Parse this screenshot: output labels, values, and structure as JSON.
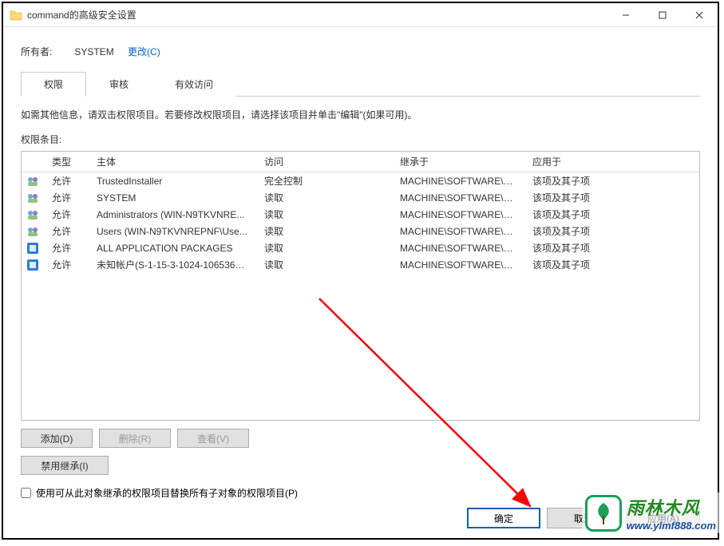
{
  "window": {
    "title": "command的高级安全设置"
  },
  "owner": {
    "label": "所有者:",
    "value": "SYSTEM",
    "change_link": "更改(C)"
  },
  "tabs": {
    "permissions": "权限",
    "auditing": "审核",
    "effective": "有效访问"
  },
  "info_text": "如需其他信息，请双击权限项目。若要修改权限项目，请选择该项目并单击\"编辑\"(如果可用)。",
  "entries_label": "权限条目:",
  "columns": {
    "type": "类型",
    "principal": "主体",
    "access": "访问",
    "inherited": "继承于",
    "applies": "应用于"
  },
  "rows": [
    {
      "icon": "users",
      "type": "允许",
      "principal": "TrustedInstaller",
      "access": "完全控制",
      "inherited": "MACHINE\\SOFTWARE\\Cl...",
      "applies": "该项及其子项"
    },
    {
      "icon": "users",
      "type": "允许",
      "principal": "SYSTEM",
      "access": "读取",
      "inherited": "MACHINE\\SOFTWARE\\Cl...",
      "applies": "该项及其子项"
    },
    {
      "icon": "users",
      "type": "允许",
      "principal": "Administrators (WIN-N9TKVNRE...",
      "access": "读取",
      "inherited": "MACHINE\\SOFTWARE\\Cl...",
      "applies": "该项及其子项"
    },
    {
      "icon": "users",
      "type": "允许",
      "principal": "Users (WIN-N9TKVNREPNF\\Use...",
      "access": "读取",
      "inherited": "MACHINE\\SOFTWARE\\Cl...",
      "applies": "该项及其子项"
    },
    {
      "icon": "app",
      "type": "允许",
      "principal": "ALL APPLICATION PACKAGES",
      "access": "读取",
      "inherited": "MACHINE\\SOFTWARE\\Cl...",
      "applies": "该项及其子项"
    },
    {
      "icon": "app",
      "type": "允许",
      "principal": "未知帐户(S-1-15-3-1024-1065365...",
      "access": "读取",
      "inherited": "MACHINE\\SOFTWARE\\Cl...",
      "applies": "该项及其子项"
    }
  ],
  "buttons": {
    "add": "添加(D)",
    "remove": "删除(R)",
    "view": "查看(V)",
    "disable_inherit": "禁用继承(I)"
  },
  "checkbox_label": "使用可从此对象继承的权限项目替换所有子对象的权限项目(P)",
  "footer": {
    "ok": "确定",
    "cancel": "取消",
    "apply": "应用(A)"
  },
  "watermark": {
    "cn": "雨林木风",
    "url": "www.ylmf888.com"
  },
  "colors": {
    "link": "#0066cc",
    "arrow": "#ff0000"
  }
}
